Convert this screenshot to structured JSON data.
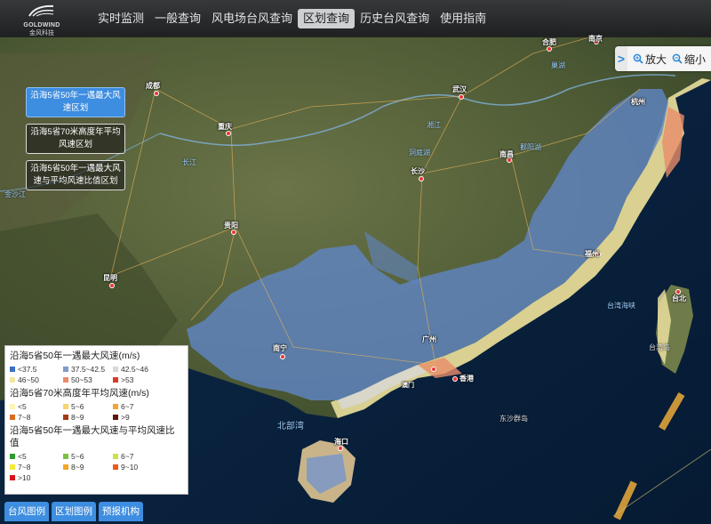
{
  "brand": {
    "name": "GOLDWIND",
    "sub": "金风科技"
  },
  "nav": [
    {
      "label": "实时监测"
    },
    {
      "label": "一般查询"
    },
    {
      "label": "风电场台风查询"
    },
    {
      "label": "区划查询"
    },
    {
      "label": "历史台风查询"
    },
    {
      "label": "使用指南"
    }
  ],
  "active_nav": "区划查询",
  "zoom": {
    "toggle": ">",
    "zoom_in": "放大",
    "zoom_out": "缩小"
  },
  "region_buttons": [
    {
      "label": "沿海5省50年一遇最大风速区划",
      "active": true
    },
    {
      "label": "沿海5省70米高度年平均风速区划",
      "active": false
    },
    {
      "label": "沿海5省50年一遇最大风速与平均风速比值区划",
      "active": false
    }
  ],
  "legend": {
    "sections": [
      {
        "title": "沿海5省50年一遇最大风速(m/s)",
        "items": [
          {
            "label": "<37.5",
            "color": "#3b6fc7"
          },
          {
            "label": "37.5~42.5",
            "color": "#7f9cc8"
          },
          {
            "label": "42.5~46",
            "color": "#d8d8d8"
          },
          {
            "label": "46~50",
            "color": "#f2e5a3"
          },
          {
            "label": "50~53",
            "color": "#e98c6a"
          },
          {
            "label": ">53",
            "color": "#d83b2a"
          }
        ]
      },
      {
        "title": "沿海5省70米高度年平均风速(m/s)",
        "items": [
          {
            "label": "<5",
            "color": "#fdf3b5"
          },
          {
            "label": "5~6",
            "color": "#f9d36c"
          },
          {
            "label": "6~7",
            "color": "#f3a33a"
          },
          {
            "label": "7~8",
            "color": "#d86a1e"
          },
          {
            "label": "8~9",
            "color": "#a33a16"
          },
          {
            "label": ">9",
            "color": "#5e160c"
          }
        ]
      },
      {
        "title": "沿海5省50年一遇最大风速与平均风速比值",
        "items": [
          {
            "label": "<5",
            "color": "#2f9b2f"
          },
          {
            "label": "5~6",
            "color": "#7ac143"
          },
          {
            "label": "6~7",
            "color": "#c8e44a"
          },
          {
            "label": "7~8",
            "color": "#f4e93c"
          },
          {
            "label": "8~9",
            "color": "#f5a623"
          },
          {
            "label": "9~10",
            "color": "#ea5a1c"
          },
          {
            "label": ">10",
            "color": "#d7141b"
          }
        ]
      }
    ]
  },
  "bottom_tabs": [
    {
      "label": "台风图例"
    },
    {
      "label": "区划图例"
    },
    {
      "label": "预报机构"
    }
  ],
  "map": {
    "cities": [
      {
        "name": "成都"
      },
      {
        "name": "重庆"
      },
      {
        "name": "武汉"
      },
      {
        "name": "长沙"
      },
      {
        "name": "南昌"
      },
      {
        "name": "贵阳"
      },
      {
        "name": "昆明"
      },
      {
        "name": "南宁"
      },
      {
        "name": "广州"
      },
      {
        "name": "香港"
      },
      {
        "name": "海口"
      },
      {
        "name": "台北"
      },
      {
        "name": "合肥"
      },
      {
        "name": "南京"
      },
      {
        "name": "杭州"
      },
      {
        "name": "福州"
      },
      {
        "name": "澳门"
      }
    ],
    "geo_labels": [
      {
        "name": "洞庭湖"
      },
      {
        "name": "鄱阳湖"
      },
      {
        "name": "台湾海峡"
      },
      {
        "name": "北部湾"
      },
      {
        "name": "东沙群岛"
      },
      {
        "name": "长江"
      },
      {
        "name": "金沙江"
      },
      {
        "name": "台湾岛"
      },
      {
        "name": "湘江"
      },
      {
        "name": "巢湖"
      }
    ]
  }
}
